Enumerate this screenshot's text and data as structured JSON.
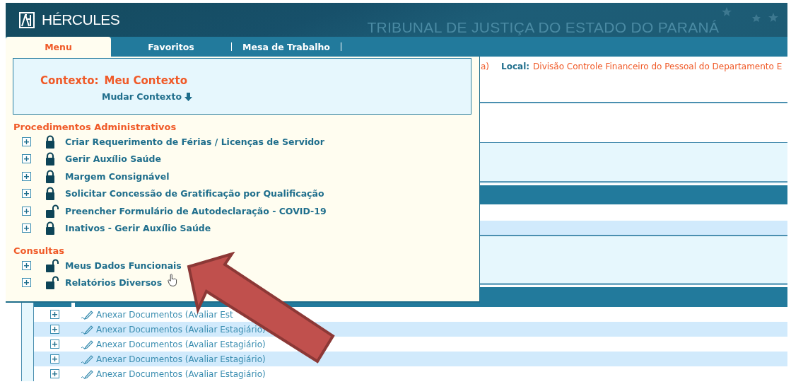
{
  "header": {
    "app_name": "HÉRCULES",
    "institution": "TRIBUNAL DE JUSTIÇA DO ESTADO DO PARANÁ"
  },
  "tabs": [
    {
      "label": "Menu",
      "selected": true
    },
    {
      "label": "Favoritos",
      "selected": false
    },
    {
      "label": "Mesa de Trabalho",
      "selected": false
    }
  ],
  "location": {
    "cut_text": "a)",
    "label": "Local:",
    "value": "Divisão Controle Financeiro do Pessoal do Departamento E"
  },
  "menu": {
    "context": {
      "label": "Contexto:",
      "value": "Meu Contexto",
      "change_link": "Mudar Contexto"
    },
    "sections": [
      {
        "title": "Procedimentos Administrativos",
        "items": [
          {
            "label": "Criar Requerimento de Férias / Licenças de Servidor",
            "locked": true,
            "expanded": false
          },
          {
            "label": "Gerir Auxílio Saúde",
            "locked": true,
            "expanded": false
          },
          {
            "label": "Margem Consignável",
            "locked": true,
            "expanded": false
          },
          {
            "label": "Solicitar Concessão de Gratificação por Qualificação",
            "locked": true,
            "expanded": false
          },
          {
            "label": "Preencher Formulário de Autodeclaração - COVID-19",
            "locked": false,
            "expanded": false
          },
          {
            "label": "Inativos - Gerir Auxílio Saúde",
            "locked": true,
            "expanded": false
          }
        ]
      },
      {
        "title": "Consultas",
        "items": [
          {
            "label": "Meus Dados Funcionais",
            "locked": false,
            "expanded": false
          },
          {
            "label": "Relatórios Diversos",
            "locked": false,
            "expanded": false
          }
        ]
      }
    ]
  },
  "tasks": [
    {
      "label": "Anexar Documentos (Avaliar Est",
      "expanded": false
    },
    {
      "label": "Anexar Documentos (Avaliar Estagiário)",
      "expanded": false
    },
    {
      "label": "Anexar Documentos (Avaliar Estagiário)",
      "expanded": false
    },
    {
      "label": "Anexar Documentos (Avaliar Estagiário)",
      "expanded": false
    },
    {
      "label": "Anexar Documentos (Avaliar Estagiário)",
      "expanded": false
    }
  ]
}
